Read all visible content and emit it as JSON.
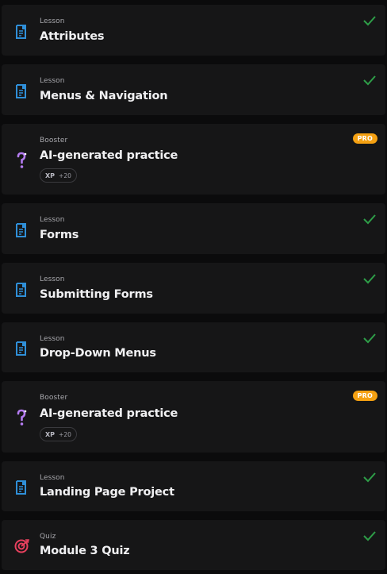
{
  "items": [
    {
      "type": "Lesson",
      "title": "Attributes",
      "kind": "lesson",
      "completed": true
    },
    {
      "type": "Lesson",
      "title": "Menus & Navigation",
      "kind": "lesson",
      "completed": true
    },
    {
      "type": "Booster",
      "title": "AI-generated practice",
      "kind": "booster",
      "badge": "PRO",
      "xp_label": "XP",
      "xp_value": "+20"
    },
    {
      "type": "Lesson",
      "title": "Forms",
      "kind": "lesson",
      "completed": true
    },
    {
      "type": "Lesson",
      "title": "Submitting Forms",
      "kind": "lesson",
      "completed": true
    },
    {
      "type": "Lesson",
      "title": "Drop-Down Menus",
      "kind": "lesson",
      "completed": true
    },
    {
      "type": "Booster",
      "title": "AI-generated practice",
      "kind": "booster",
      "badge": "PRO",
      "xp_label": "XP",
      "xp_value": "+20"
    },
    {
      "type": "Lesson",
      "title": "Landing Page Project",
      "kind": "lesson",
      "completed": true
    },
    {
      "type": "Quiz",
      "title": "Module 3 Quiz",
      "kind": "quiz",
      "completed": true
    }
  ],
  "colors": {
    "lesson_icon": "#2f8fd8",
    "booster_icon": "#b57cf2",
    "quiz_icon": "#e8405e",
    "check": "#2e9e48",
    "pro_badge": "#f5a112"
  }
}
